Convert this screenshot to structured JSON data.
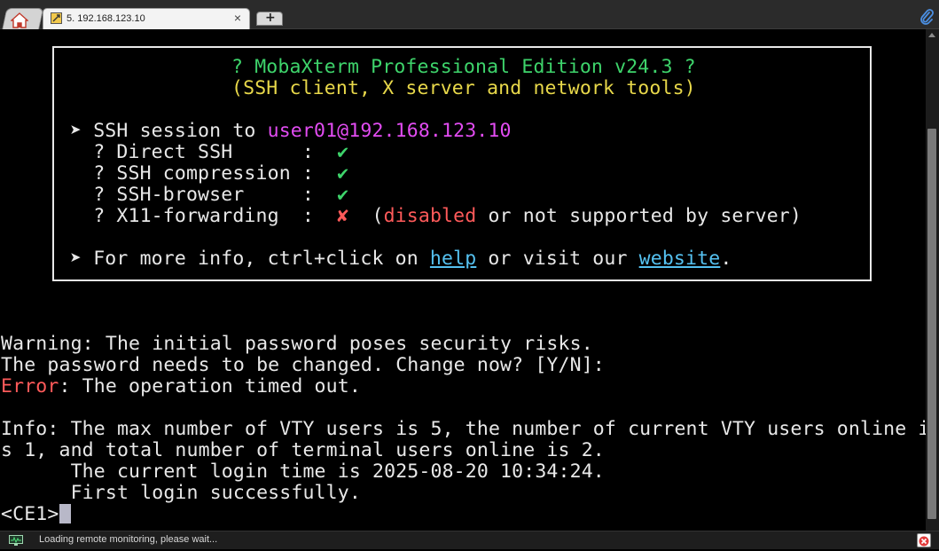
{
  "tabs": {
    "home_icon": "home-icon",
    "session": {
      "icon": "ssh-session-icon",
      "label": "5. 192.168.123.10",
      "close": "×"
    },
    "new_tab_label": "+",
    "attach_icon": "paperclip-icon"
  },
  "banner": {
    "title": "? MobaXterm Professional Edition v24.3 ?",
    "subtitle": "(SSH client, X server and network tools)",
    "session_prefix": "➤ SSH session to ",
    "session_target": "user01@192.168.123.10",
    "options": [
      {
        "label": "  ? Direct SSH      :  ",
        "mark": "✔",
        "status": "ok"
      },
      {
        "label": "  ? SSH compression :  ",
        "mark": "✔",
        "status": "ok"
      },
      {
        "label": "  ? SSH-browser     :  ",
        "mark": "✔",
        "status": "ok"
      },
      {
        "label": "  ? X11-forwarding  :  ",
        "mark": "✘",
        "status": "fail"
      }
    ],
    "x11_note_open": "  (",
    "x11_note_disabled": "disabled",
    "x11_note_rest": " or not supported by server)",
    "info_prefix": "➤ For more info, ctrl+click on ",
    "help_link": "help",
    "info_middle": " or visit our ",
    "website_link": "website",
    "info_suffix": "."
  },
  "output": {
    "warning": "Warning: The initial password poses security risks.",
    "change_prompt": "The password needs to be changed. Change now? [Y/N]:",
    "error_label": "Error",
    "error_text": ": The operation timed out.",
    "info_line1": "Info: The max number of VTY users is 5, the number of current VTY users online i",
    "info_line2": "s 1, and total number of terminal users online is 2.",
    "login_time": "      The current login time is 2025-08-20 10:34:24.",
    "first_login": "      First login successfully.",
    "prompt": "<CE1>"
  },
  "status": {
    "monitor_icon": "monitor-icon",
    "text": "Loading remote monitoring, please wait...",
    "close_icon": "close-icon"
  },
  "colors": {
    "title_green": "#3ed46b",
    "subtitle_yellow": "#e8d84a",
    "target_magenta": "#e24cf2",
    "fail_red": "#ff5a5a",
    "link_blue": "#55c1f0",
    "text": "#e8e8e8",
    "background": "#000000"
  }
}
